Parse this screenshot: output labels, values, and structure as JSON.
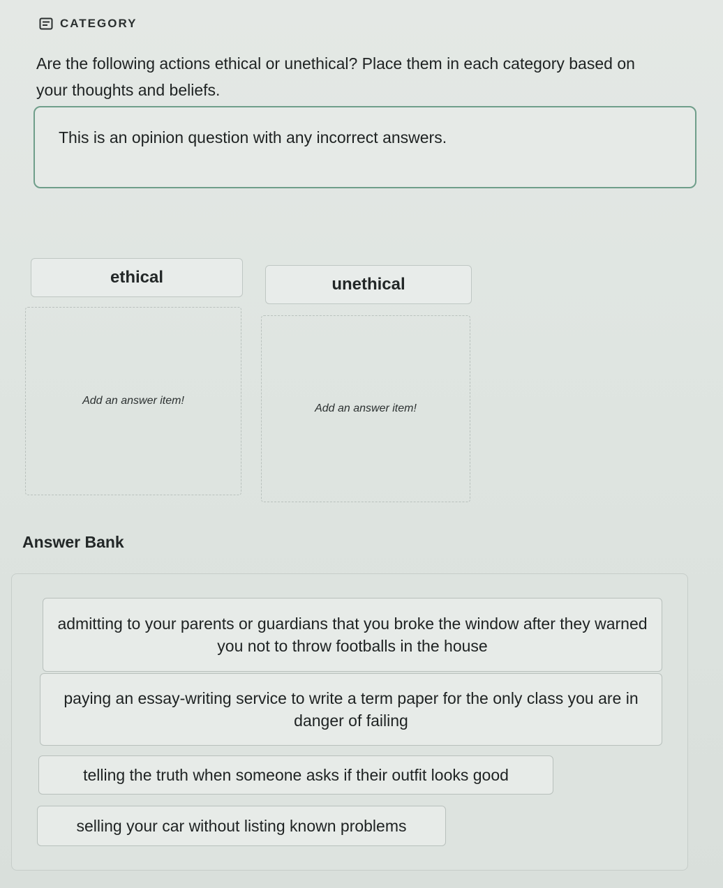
{
  "header": {
    "icon": "category-icon",
    "label": "CATEGORY"
  },
  "question": {
    "text": "Are the following actions ethical or unethical? Place them in each category based on your thoughts and beliefs."
  },
  "note": {
    "text": "This is an opinion question with any incorrect answers."
  },
  "categories": [
    {
      "label": "ethical",
      "placeholder": "Add an answer item!"
    },
    {
      "label": "unethical",
      "placeholder": "Add an answer item!"
    }
  ],
  "answer_bank": {
    "title": "Answer Bank",
    "items": [
      "admitting to your parents or guardians that you broke the window after they warned you not to throw footballs in the house",
      "paying an essay-writing service to write a term paper for the only class you are in danger of failing",
      "telling the truth when someone asks if their outfit looks good",
      "selling your car without listing known problems"
    ]
  },
  "colors": {
    "accent_border": "#6f9e8a",
    "background": "#dde3df"
  }
}
